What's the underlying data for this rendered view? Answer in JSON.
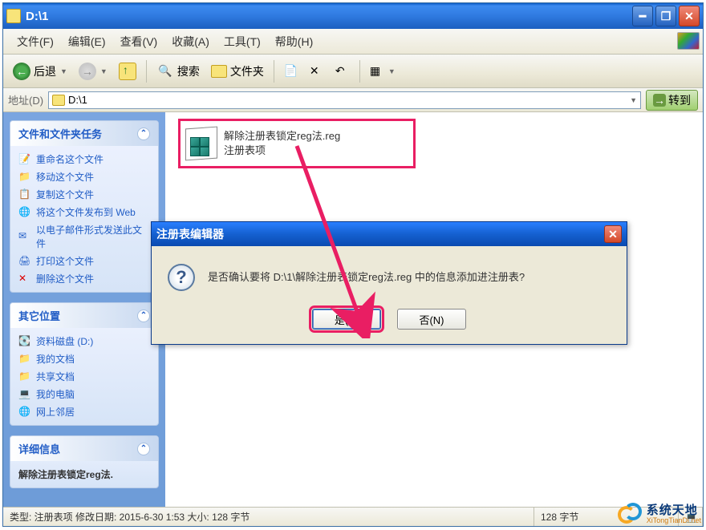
{
  "window": {
    "title": "D:\\1"
  },
  "menu": {
    "file": "文件(F)",
    "edit": "编辑(E)",
    "view": "查看(V)",
    "favorites": "收藏(A)",
    "tools": "工具(T)",
    "help": "帮助(H)"
  },
  "toolbar": {
    "back": "后退",
    "search": "搜索",
    "folders": "文件夹"
  },
  "address": {
    "label": "地址(D)",
    "value": "D:\\1",
    "go": "转到"
  },
  "sidebar": {
    "panel1": {
      "title": "文件和文件夹任务",
      "tasks": [
        "重命名这个文件",
        "移动这个文件",
        "复制这个文件",
        "将这个文件发布到 Web",
        "以电子邮件形式发送此文件",
        "打印这个文件",
        "删除这个文件"
      ]
    },
    "panel2": {
      "title": "其它位置",
      "places": [
        "资料磁盘 (D:)",
        "我的文档",
        "共享文档",
        "我的电脑",
        "网上邻居"
      ]
    },
    "panel3": {
      "title": "详细信息",
      "line": "解除注册表锁定reg法."
    }
  },
  "file": {
    "name": "解除注册表锁定reg法.reg",
    "type_line": "注册表项"
  },
  "dialog": {
    "title": "注册表编辑器",
    "message": "是否确认要将 D:\\1\\解除注册表锁定reg法.reg 中的信息添加进注册表?",
    "yes": "是(Y)",
    "no": "否(N)"
  },
  "status": {
    "left": "类型: 注册表项 修改日期: 2015-6-30 1:53 大小: 128 字节",
    "mid": "128 字节"
  },
  "watermark": {
    "cn": "系统天地",
    "en": "XiTongTianDi.net"
  }
}
